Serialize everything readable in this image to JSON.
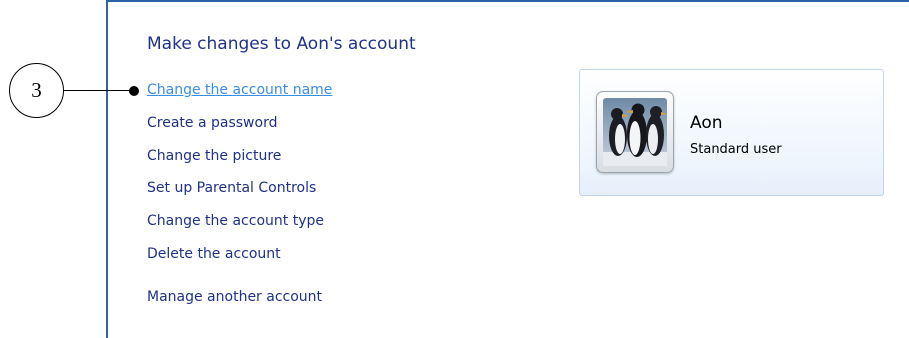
{
  "page": {
    "title": "Make changes to Aon's account"
  },
  "tasks": [
    {
      "label": "Change the account name",
      "active": true
    },
    {
      "label": "Create a password"
    },
    {
      "label": "Change the picture"
    },
    {
      "label": "Set up Parental Controls"
    },
    {
      "label": "Change the account type"
    },
    {
      "label": "Delete the account"
    },
    {
      "label": "Manage another account"
    }
  ],
  "user_card": {
    "name": "Aon",
    "account_type": "Standard user",
    "picture_icon": "penguins-picture"
  },
  "annotation": {
    "step_number": "3"
  },
  "colors": {
    "link": "#1e3287",
    "link_active": "#3b8de4",
    "panel_border": "#2f63a8",
    "card_border": "#c2d6ea"
  }
}
